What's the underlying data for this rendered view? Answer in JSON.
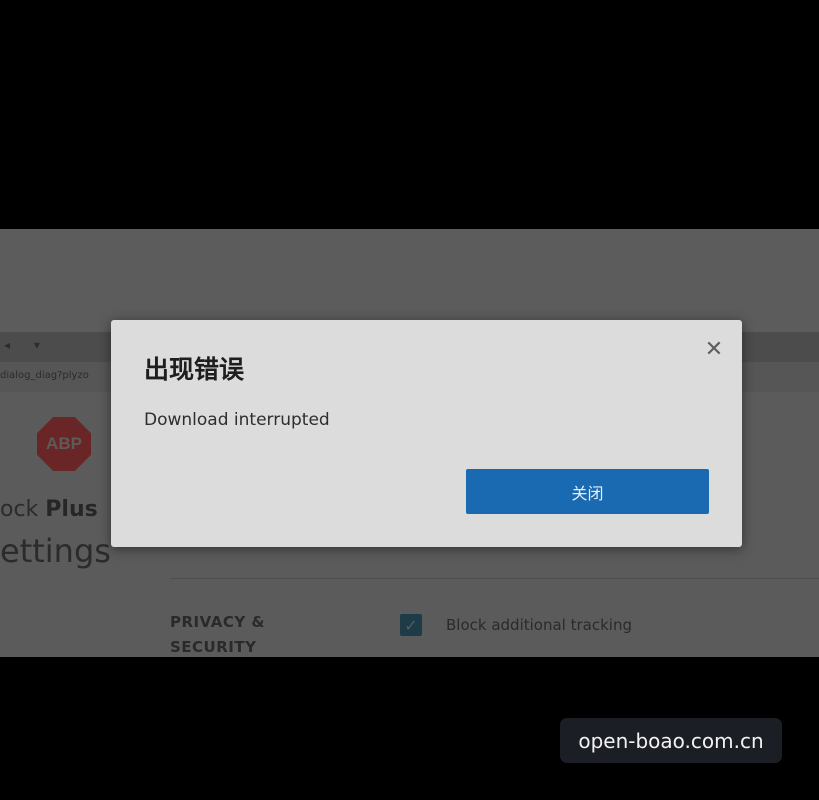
{
  "background_page": {
    "nav_arrows": "◂ ▾",
    "url_fragment": "dialog_diag?plyzo",
    "logo_text": "ABP",
    "app_name_partial": "ock ",
    "app_name_plus": "Plus",
    "page_title_partial": "ettings",
    "section_label": "PRIVACY & SECURITY",
    "option_label": "Block additional tracking",
    "option_checked": true
  },
  "dialog": {
    "title": "出现错误",
    "message": "Download interrupted",
    "close_icon": "close-icon",
    "close_glyph": "✕",
    "primary_button_label": "关闭",
    "button_color": "#1a6ab2"
  },
  "watermark": {
    "text": "open-boao.com.cn"
  }
}
